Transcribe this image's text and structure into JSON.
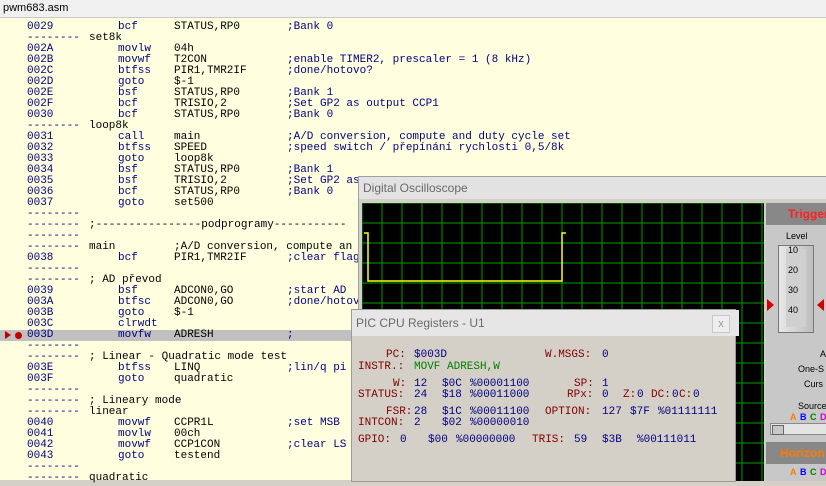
{
  "editor": {
    "title": "pwm683.asm",
    "lines": [
      {
        "addr": "0029",
        "mn": "bcf",
        "op": "STATUS,RP0",
        "cm": ";Bank 0"
      },
      {
        "addr": "--------",
        "lbl": "set8k"
      },
      {
        "addr": "002A",
        "mn": "movlw",
        "op": "04h"
      },
      {
        "addr": "002B",
        "mn": "movwf",
        "op": "T2CON",
        "cm": ";enable TIMER2, prescaler = 1 (8 kHz)"
      },
      {
        "addr": "002C",
        "mn": "btfss",
        "op": "PIR1,TMR2IF",
        "cm": ";done/hotovo?"
      },
      {
        "addr": "002D",
        "mn": "goto",
        "op": "$-1"
      },
      {
        "addr": "002E",
        "mn": "bsf",
        "op": "STATUS,RP0",
        "cm": ";Bank 1"
      },
      {
        "addr": "002F",
        "mn": "bcf",
        "op": "TRISIO,2",
        "cm": ";Set GP2 as output CCP1"
      },
      {
        "addr": "0030",
        "mn": "bcf",
        "op": "STATUS,RP0",
        "cm": ";Bank 0"
      },
      {
        "addr": "--------",
        "lbl": "loop8k"
      },
      {
        "addr": "0031",
        "mn": "call",
        "op": "main",
        "cm": ";A/D conversion, compute and duty cycle set"
      },
      {
        "addr": "0032",
        "mn": "btfss",
        "op": "SPEED",
        "cm": ";speed switch / přepínání rychlosti 0,5/8k"
      },
      {
        "addr": "0033",
        "mn": "goto",
        "op": "loop8k"
      },
      {
        "addr": "0034",
        "mn": "bsf",
        "op": "STATUS,RP0",
        "cm": ";Bank 1"
      },
      {
        "addr": "0035",
        "mn": "bsf",
        "op": "TRISIO,2",
        "cm": ";Set GP2 as"
      },
      {
        "addr": "0036",
        "mn": "bcf",
        "op": "STATUS,RP0",
        "cm": ";Bank 0"
      },
      {
        "addr": "0037",
        "mn": "goto",
        "op": "set500"
      },
      {
        "addr": "--------"
      },
      {
        "addr": "--------",
        "lbl": ";----------------podprogramy-----------"
      },
      {
        "addr": "--------"
      },
      {
        "addr": "--------",
        "lbl": "main",
        "op": ";A/D conversion, compute an"
      },
      {
        "addr": "0038",
        "mn": "bcf",
        "op": "PIR1,TMR2IF",
        "cm": ";clear flag"
      },
      {
        "addr": "--------"
      },
      {
        "addr": "--------",
        "lbl": "; AD převod"
      },
      {
        "addr": "0039",
        "mn": "bsf",
        "op": "ADCON0,GO",
        "cm": ";start AD"
      },
      {
        "addr": "003A",
        "mn": "btfsc",
        "op": "ADCON0,GO",
        "cm": ";done/hotov"
      },
      {
        "addr": "003B",
        "mn": "goto",
        "op": "$-1"
      },
      {
        "addr": "003C",
        "mn": "clrwdt"
      },
      {
        "addr": "003D",
        "mn": "movfw",
        "op": "ADRESH",
        "cm": ";",
        "current": true
      },
      {
        "addr": "--------"
      },
      {
        "addr": "--------",
        "lbl": "; Linear - Quadratic mode test"
      },
      {
        "addr": "003E",
        "mn": "btfss",
        "op": "LINQ",
        "cm": ";lin/q pi"
      },
      {
        "addr": "003F",
        "mn": "goto",
        "op": "quadratic"
      },
      {
        "addr": "--------"
      },
      {
        "addr": "--------",
        "lbl": "; Lineary mode"
      },
      {
        "addr": "--------",
        "lbl": "linear"
      },
      {
        "addr": "0040",
        "mn": "movwf",
        "op": "CCPR1L",
        "cm": ";set MSB"
      },
      {
        "addr": "0041",
        "mn": "movlw",
        "op": "00ch"
      },
      {
        "addr": "0042",
        "mn": "movwf",
        "op": "CCP1CON",
        "cm": ";clear LS"
      },
      {
        "addr": "0043",
        "mn": "goto",
        "op": "testend"
      },
      {
        "addr": "--------"
      },
      {
        "addr": "--------",
        "lbl": "quadratic"
      }
    ]
  },
  "oscilloscope": {
    "title": "Digital Oscilloscope",
    "trigger_label": "Trigger",
    "level_label": "Level",
    "level_ticks": [
      "10",
      "20",
      "30",
      "40"
    ],
    "side_labels": [
      "A",
      "One-S",
      "Curs",
      "Source"
    ],
    "source_letters": [
      "A",
      "B",
      "C",
      "D"
    ],
    "horizontal_label": "Horizon"
  },
  "cpu": {
    "title": "PIC CPU Registers - U1",
    "close_label": "x",
    "PC": "$003D",
    "WMSGS_label": "W.MSGS:",
    "WMSGS": "0",
    "INSTR": "MOVF ADRESH,W",
    "W": "12",
    "W_hex": "$0C",
    "W_bin": "%00001100",
    "SP": "1",
    "STATUS": "24",
    "STATUS_hex": "$18",
    "STATUS_bin": "%00011000",
    "RPx": "0",
    "Z": "0",
    "DC": "0",
    "C": "0",
    "FSR": "28",
    "FSR_hex": "$1C",
    "FSR_bin": "%00011100",
    "OPTION": "127",
    "OPTION_hex": "$7F",
    "OPTION_bin": "%01111111",
    "INTCON": "2",
    "INTCON_hex": "$02",
    "INTCON_bin": "%00000010",
    "GPIO": "0",
    "GPIO_hex": "$00",
    "GPIO_bin": "%00000000",
    "TRIS": "59",
    "TRIS_hex": "$3B",
    "TRIS_bin": "%00111011"
  },
  "colors": {
    "trace": "#ffff00",
    "grid": "#00a000",
    "accent_red": "#ff2020",
    "accent_orange": "#ff7a00"
  }
}
